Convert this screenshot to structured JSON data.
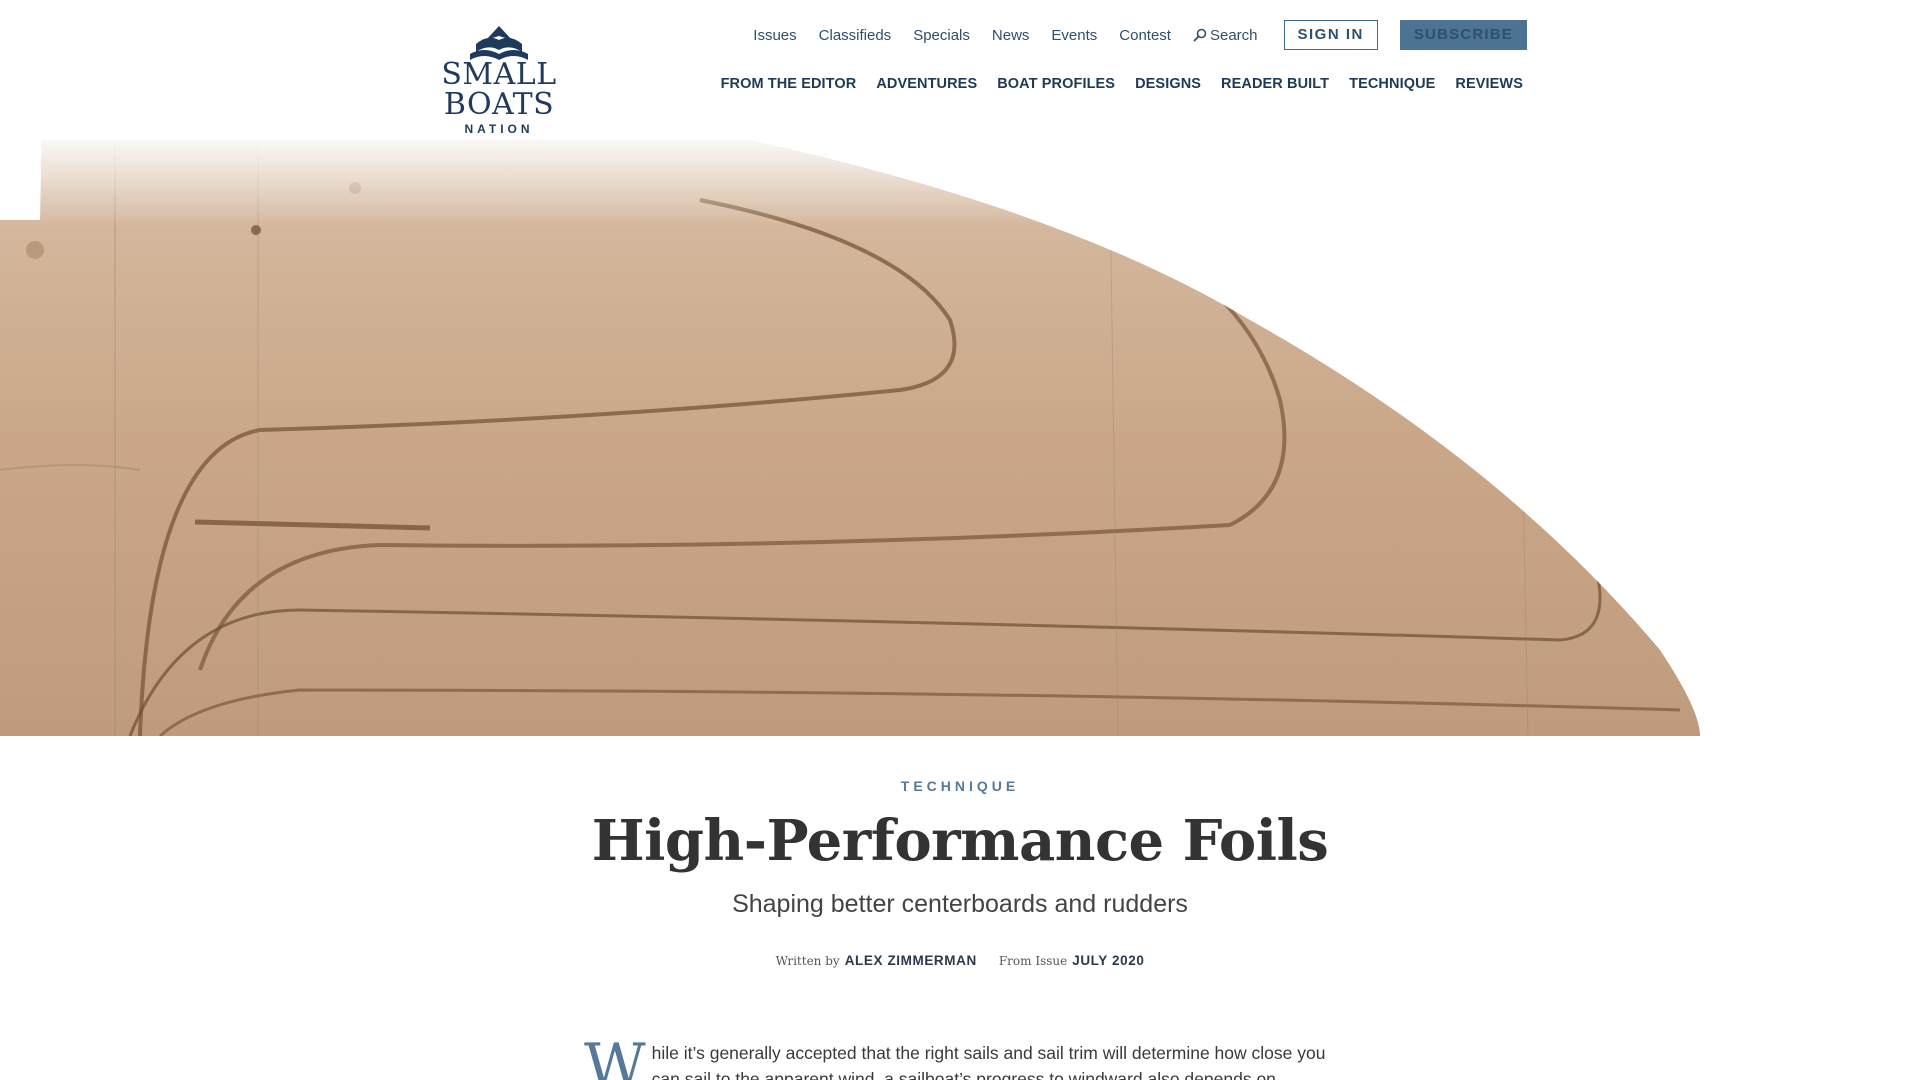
{
  "logo": {
    "brand": "SMALL BOATS",
    "sub": "NATION"
  },
  "util_nav": {
    "items": [
      "Issues",
      "Classifieds",
      "Specials",
      "News",
      "Events",
      "Contest"
    ],
    "search_label": "Search",
    "sign_in": "SIGN IN",
    "subscribe": "SUBSCRIBE"
  },
  "main_nav": {
    "items": [
      "FROM THE EDITOR",
      "ADVENTURES",
      "BOAT PROFILES",
      "DESIGNS",
      "READER BUILT",
      "TECHNIQUE",
      "REVIEWS"
    ]
  },
  "article": {
    "category": "TECHNIQUE",
    "title": "High-Performance Foils",
    "subtitle": "Shaping better centerboards and rudders",
    "written_by_label": "Written by",
    "author": "ALEX ZIMMERMAN",
    "from_issue_label": "From Issue",
    "issue": "JULY 2020",
    "dropcap": "W",
    "first_paragraph": "hile it’s generally accepted that the right sails and sail trim will determine how close you can sail to the apparent wind, a sailboat’s progress to windward also depends on"
  },
  "colors": {
    "brand_navy": "#1f3a5c",
    "accent_blue": "#4d7393",
    "kicker_blue": "#56799a",
    "wood": "#c9a98a"
  },
  "hero_image": {
    "subject": "wooden-foil-icon"
  }
}
